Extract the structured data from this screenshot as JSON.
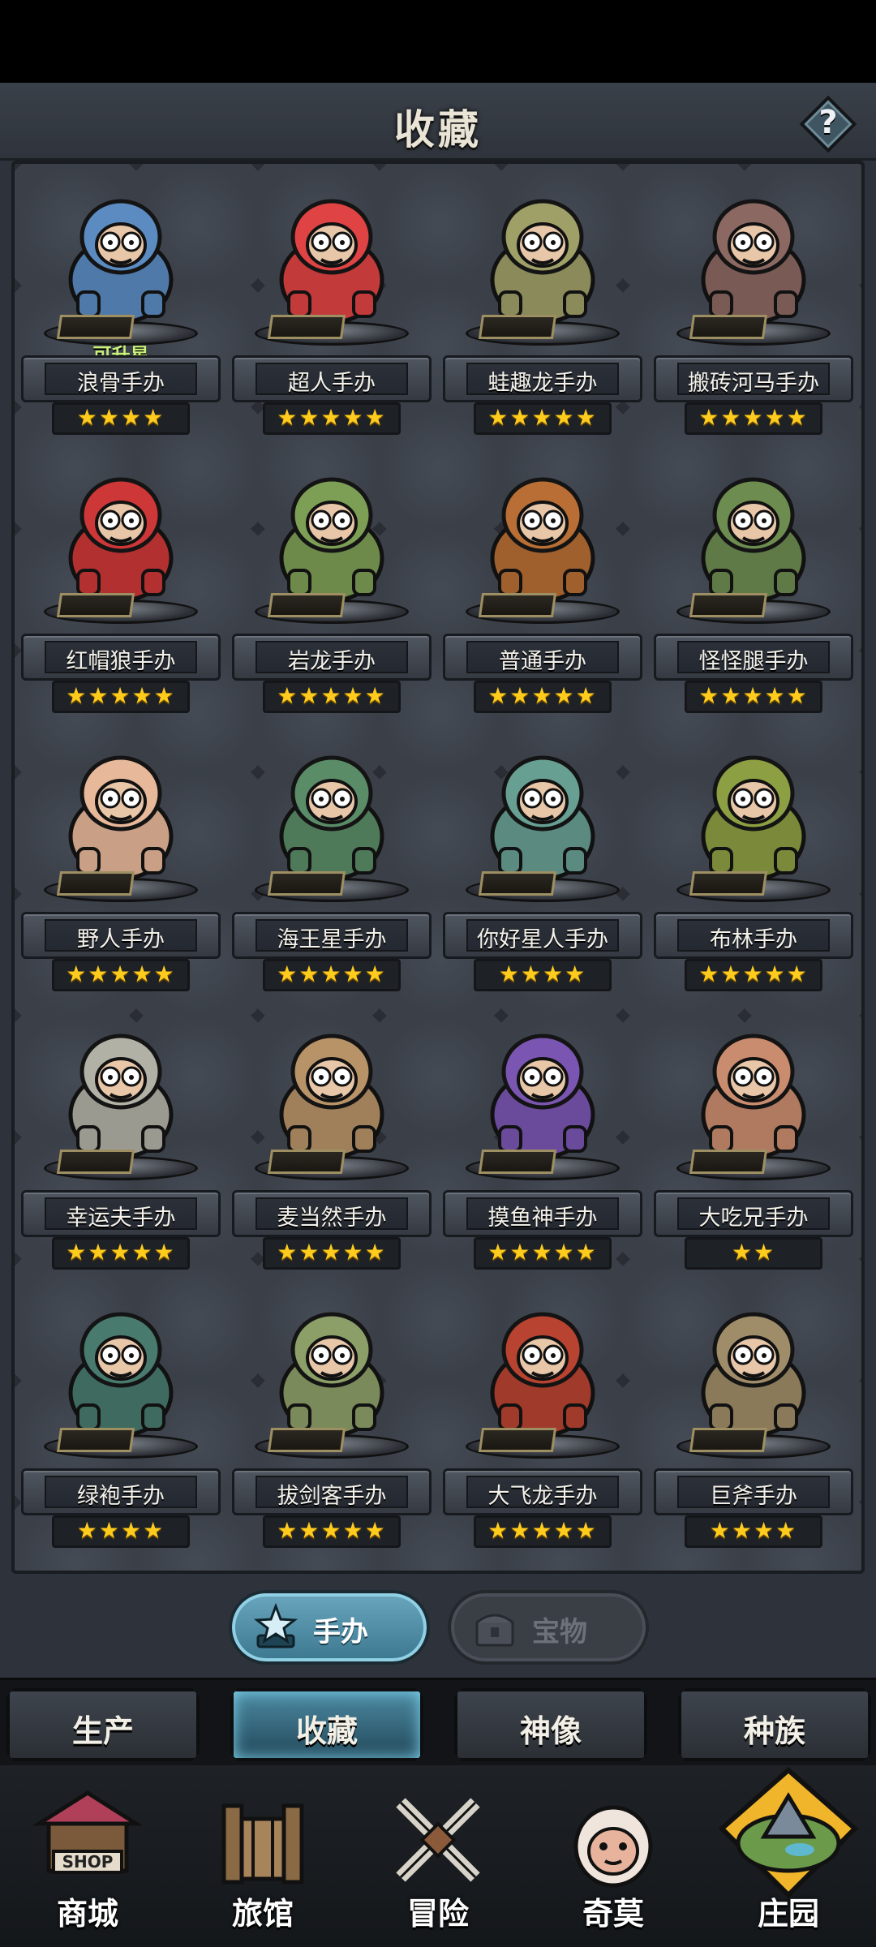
{
  "header": {
    "title": "收藏",
    "help_glyph": "?"
  },
  "figures": [
    {
      "name": "浪骨手办",
      "stars": "★★★★",
      "upgrade": "可升星",
      "icon": "skeleton-figure-icon",
      "color": "#4f79a8"
    },
    {
      "name": "超人手办",
      "stars": "★★★★★",
      "upgrade": "",
      "icon": "hero-figure-icon",
      "color": "#c23a3a"
    },
    {
      "name": "蛙趣龙手办",
      "stars": "★★★★★",
      "upgrade": "",
      "icon": "toad-dragon-figure-icon",
      "color": "#8a8a5a"
    },
    {
      "name": "搬砖河马手办",
      "stars": "★★★★★",
      "upgrade": "",
      "icon": "hippo-figure-icon",
      "color": "#7a5a55"
    },
    {
      "name": "红帽狼手办",
      "stars": "★★★★★",
      "upgrade": "",
      "icon": "red-hood-wolf-figure-icon",
      "color": "#b23030"
    },
    {
      "name": "岩龙手办",
      "stars": "★★★★★",
      "upgrade": "",
      "icon": "rock-dragon-figure-icon",
      "color": "#6d8a4a"
    },
    {
      "name": "普通手办",
      "stars": "★★★★★",
      "upgrade": "",
      "icon": "pumpkin-figure-icon",
      "color": "#a0602e"
    },
    {
      "name": "怪怪腿手办",
      "stars": "★★★★★",
      "upgrade": "",
      "icon": "weird-legs-figure-icon",
      "color": "#5f7a46"
    },
    {
      "name": "野人手办",
      "stars": "★★★★★",
      "upgrade": "",
      "icon": "wildman-figure-icon",
      "color": "#c9a085"
    },
    {
      "name": "海王星手办",
      "stars": "★★★★★",
      "upgrade": "",
      "icon": "neptune-figure-icon",
      "color": "#4f7a5a"
    },
    {
      "name": "你好星人手办",
      "stars": "★★★★",
      "upgrade": "",
      "icon": "alien-figure-icon",
      "color": "#5a8a80"
    },
    {
      "name": "布林手办",
      "stars": "★★★★★",
      "upgrade": "",
      "icon": "goblin-figure-icon",
      "color": "#7a8a3a"
    },
    {
      "name": "幸运夫手办",
      "stars": "★★★★★",
      "upgrade": "",
      "icon": "wizard-figure-icon",
      "color": "#9a9a90"
    },
    {
      "name": "麦当然手办",
      "stars": "★★★★★",
      "upgrade": "",
      "icon": "bag-head-figure-icon",
      "color": "#a0805a"
    },
    {
      "name": "摸鱼神手办",
      "stars": "★★★★★",
      "upgrade": "",
      "icon": "reaper-figure-icon",
      "color": "#6a4a9a"
    },
    {
      "name": "大吃兄手办",
      "stars": "★★",
      "upgrade": "",
      "icon": "glutton-figure-icon",
      "color": "#b07a60"
    },
    {
      "name": "绿袍手办",
      "stars": "★★★★",
      "upgrade": "",
      "icon": "green-robe-figure-icon",
      "color": "#3f6a60"
    },
    {
      "name": "拔剑客手办",
      "stars": "★★★★★",
      "upgrade": "",
      "icon": "swordsman-figure-icon",
      "color": "#7a8a5a"
    },
    {
      "name": "大飞龙手办",
      "stars": "★★★★★",
      "upgrade": "",
      "icon": "fire-dragon-figure-icon",
      "color": "#a03a2a"
    },
    {
      "name": "巨斧手办",
      "stars": "★★★★",
      "upgrade": "",
      "icon": "giant-axe-figure-icon",
      "color": "#8a7a5a"
    }
  ],
  "subtabs": {
    "figures_label": "手办",
    "treasures_label": "宝物"
  },
  "section_tabs": [
    "生产",
    "收藏",
    "神像",
    "种族"
  ],
  "section_active_index": 1,
  "bottom_nav": [
    {
      "label": "商城",
      "icon": "shop-icon",
      "sign": "SHOP"
    },
    {
      "label": "旅馆",
      "icon": "inn-gate-icon"
    },
    {
      "label": "冒险",
      "icon": "crossed-swords-icon"
    },
    {
      "label": "奇莫",
      "icon": "kimo-character-icon"
    },
    {
      "label": "庄园",
      "icon": "manor-island-icon"
    }
  ],
  "colors": {
    "star": "#ffcc1d",
    "upgrade_text": "#c9f27a",
    "active_tab": "#4c8aa2",
    "panel": "#3b4049"
  }
}
